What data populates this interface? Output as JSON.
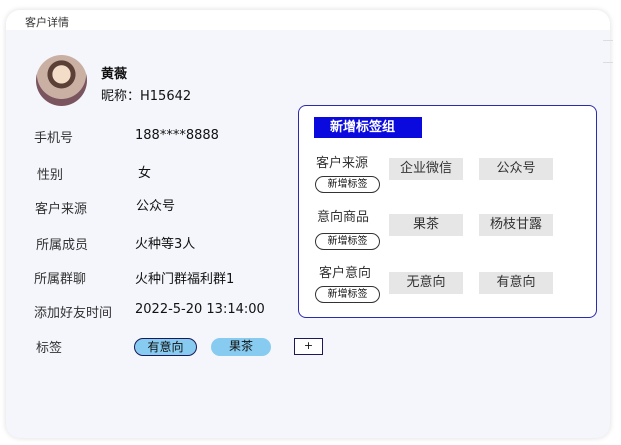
{
  "window": {
    "title": "客户详情"
  },
  "profile": {
    "name": "黄薇",
    "nickname": "昵称：H15642"
  },
  "fields": {
    "phone": {
      "label": "手机号",
      "value": "188****8888"
    },
    "gender": {
      "label": "性别",
      "value": "女"
    },
    "source": {
      "label": "客户来源",
      "value": "公众号"
    },
    "members": {
      "label": "所属成员",
      "value": "火种等3人"
    },
    "group": {
      "label": "所属群聊",
      "value": "火种门群福利群1"
    },
    "added_time": {
      "label": "添加好友时间",
      "value": "2022-5-20  13:14:00"
    },
    "tags": {
      "label": "标签",
      "items": [
        "有意向",
        "果茶"
      ],
      "add_label": "+"
    }
  },
  "tag_panel": {
    "title": "新增标签组",
    "groups": [
      {
        "label": "客户来源",
        "add_label": "新增标签",
        "options": [
          "企业微信",
          "公众号"
        ]
      },
      {
        "label": "意向商品",
        "add_label": "新增标签",
        "options": [
          "果茶",
          "杨枝甘露"
        ]
      },
      {
        "label": "客户意向",
        "add_label": "新增标签",
        "options": [
          "无意向",
          "有意向"
        ]
      }
    ]
  },
  "colors": {
    "accent": "#0a0adf",
    "tag_fill": "#87ccf0",
    "panel_border": "#2b2bb0"
  }
}
